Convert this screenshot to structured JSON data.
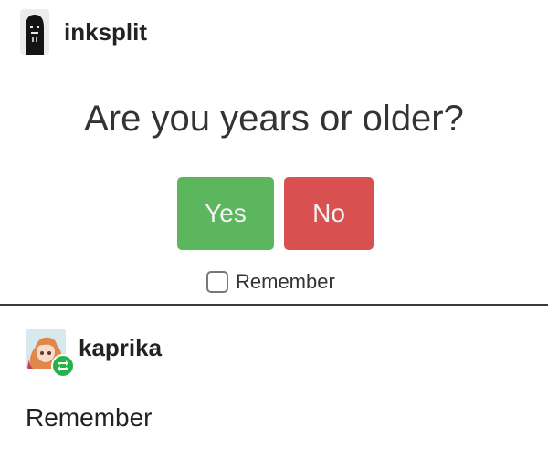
{
  "post1": {
    "username": "inksplit",
    "question": "Are you years or older?",
    "yes_label": "Yes",
    "no_label": "No",
    "remember_label": "Remember",
    "remember_checked": false
  },
  "post2": {
    "username": "kaprika",
    "text": "Remember"
  },
  "colors": {
    "yes": "#5bb65d",
    "no": "#d95050",
    "reblog_badge": "#26b24b"
  },
  "icons": {
    "avatar1": "hooded-figure-avatar",
    "avatar2": "anime-character-avatar",
    "badge": "reblog-icon"
  }
}
